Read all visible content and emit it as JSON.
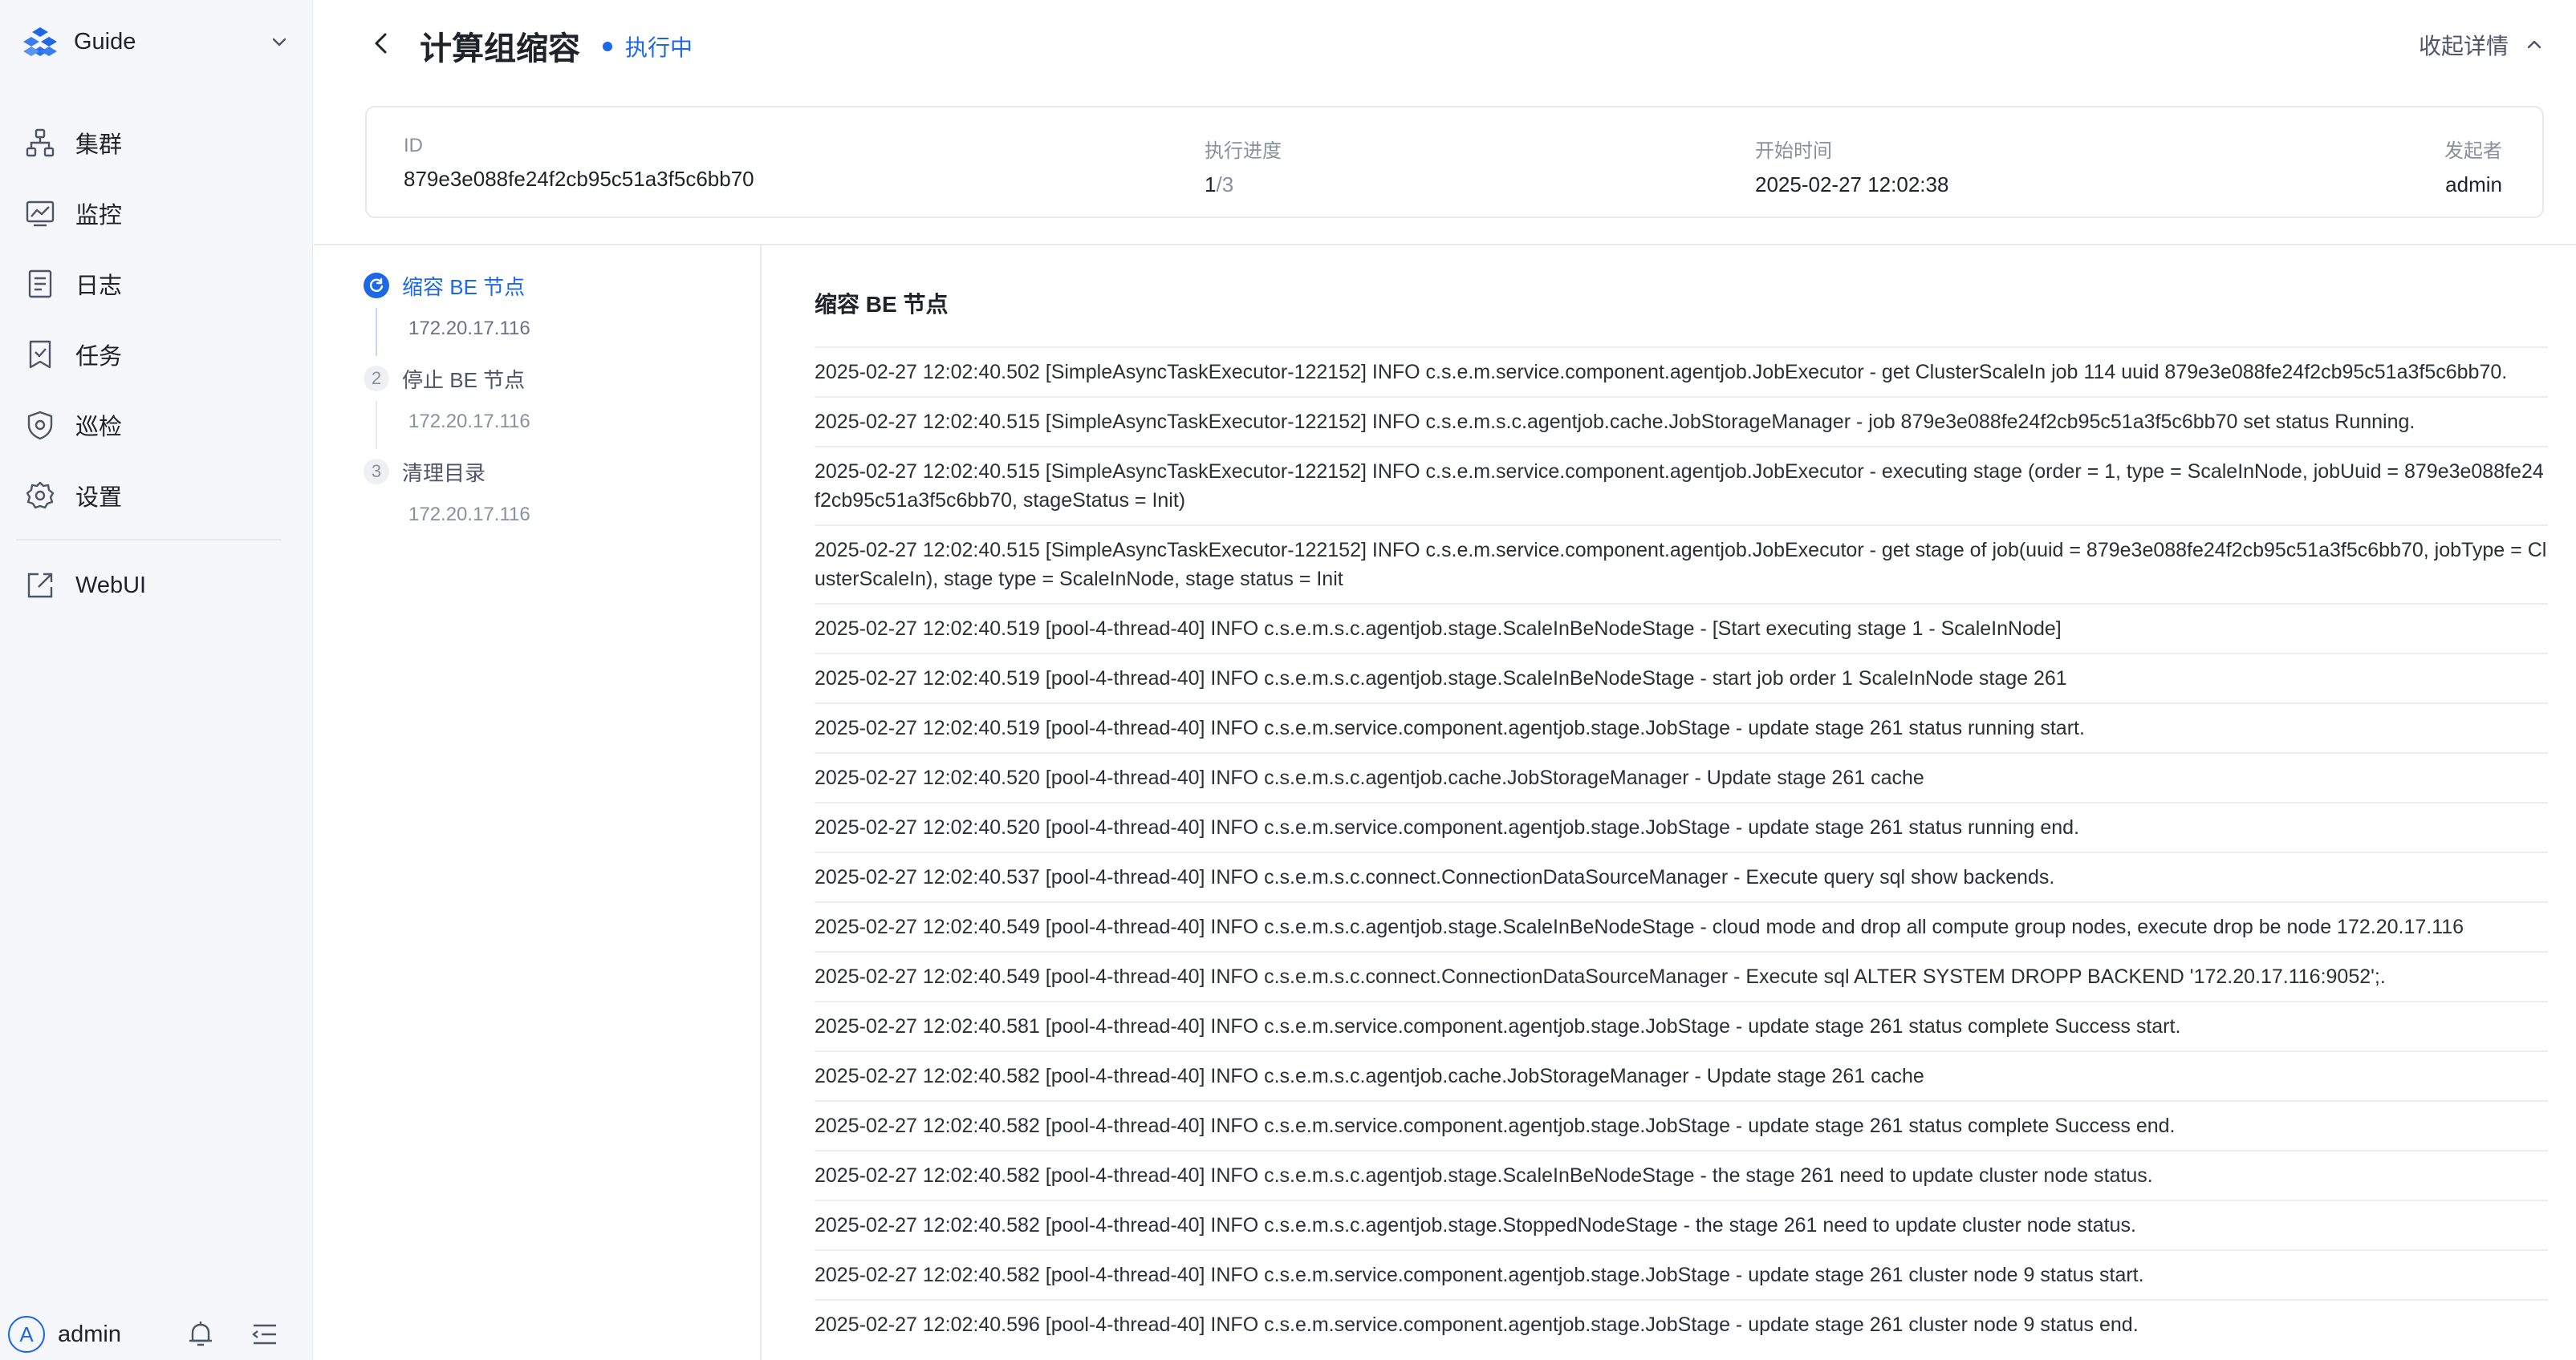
{
  "sidebar": {
    "brand": "Guide",
    "items": [
      {
        "label": "集群",
        "icon": "cluster-icon"
      },
      {
        "label": "监控",
        "icon": "monitor-icon"
      },
      {
        "label": "日志",
        "icon": "log-icon"
      },
      {
        "label": "任务",
        "icon": "task-icon"
      },
      {
        "label": "巡检",
        "icon": "inspection-icon"
      },
      {
        "label": "设置",
        "icon": "settings-icon"
      }
    ],
    "webui": {
      "label": "WebUI",
      "icon": "external-link-icon"
    },
    "user": {
      "avatar_letter": "A",
      "name": "admin"
    }
  },
  "header": {
    "title": "计算组缩容",
    "status": "执行中",
    "collapse_label": "收起详情"
  },
  "info": {
    "id_label": "ID",
    "id_value": "879e3e088fe24f2cb95c51a3f5c6bb70",
    "progress_label": "执行进度",
    "progress_current": "1",
    "progress_sep": "/",
    "progress_total": "3",
    "start_label": "开始时间",
    "start_value": "2025-02-27 12:02:38",
    "initiator_label": "发起者",
    "initiator_value": "admin"
  },
  "steps": [
    {
      "index": "1",
      "title": "缩容 BE 节点",
      "ip": "172.20.17.116",
      "active": true
    },
    {
      "index": "2",
      "title": "停止 BE 节点",
      "ip": "172.20.17.116",
      "active": false
    },
    {
      "index": "3",
      "title": "清理目录",
      "ip": "172.20.17.116",
      "active": false
    }
  ],
  "log": {
    "title": "缩容 BE 节点",
    "lines": [
      "2025-02-27 12:02:40.502 [SimpleAsyncTaskExecutor-122152] INFO  c.s.e.m.service.component.agentjob.JobExecutor - get ClusterScaleIn job 114 uuid 879e3e088fe24f2cb95c51a3f5c6bb70.",
      "2025-02-27 12:02:40.515 [SimpleAsyncTaskExecutor-122152] INFO  c.s.e.m.s.c.agentjob.cache.JobStorageManager - job 879e3e088fe24f2cb95c51a3f5c6bb70 set status Running.",
      "2025-02-27 12:02:40.515 [SimpleAsyncTaskExecutor-122152] INFO  c.s.e.m.service.component.agentjob.JobExecutor - executing stage (order = 1, type = ScaleInNode, jobUuid = 879e3e088fe24f2cb95c51a3f5c6bb70, stageStatus = Init)",
      "2025-02-27 12:02:40.515 [SimpleAsyncTaskExecutor-122152] INFO  c.s.e.m.service.component.agentjob.JobExecutor - get stage of job(uuid = 879e3e088fe24f2cb95c51a3f5c6bb70, jobType = ClusterScaleIn), stage type = ScaleInNode, stage status = Init",
      "2025-02-27 12:02:40.519 [pool-4-thread-40] INFO c.s.e.m.s.c.agentjob.stage.ScaleInBeNodeStage - [Start executing stage 1 - ScaleInNode]",
      "2025-02-27 12:02:40.519 [pool-4-thread-40] INFO  c.s.e.m.s.c.agentjob.stage.ScaleInBeNodeStage - start job order 1 ScaleInNode stage 261",
      "2025-02-27 12:02:40.519 [pool-4-thread-40] INFO  c.s.e.m.service.component.agentjob.stage.JobStage - update stage 261 status running start.",
      "2025-02-27 12:02:40.520 [pool-4-thread-40] INFO  c.s.e.m.s.c.agentjob.cache.JobStorageManager - Update stage 261 cache",
      "2025-02-27 12:02:40.520 [pool-4-thread-40] INFO  c.s.e.m.service.component.agentjob.stage.JobStage - update stage 261 status running end.",
      "2025-02-27 12:02:40.537 [pool-4-thread-40] INFO  c.s.e.m.s.c.connect.ConnectionDataSourceManager - Execute query sql show backends.",
      "2025-02-27 12:02:40.549 [pool-4-thread-40] INFO  c.s.e.m.s.c.agentjob.stage.ScaleInBeNodeStage - cloud mode and drop all compute group nodes, execute drop be node 172.20.17.116",
      "2025-02-27 12:02:40.549 [pool-4-thread-40] INFO  c.s.e.m.s.c.connect.ConnectionDataSourceManager - Execute sql ALTER SYSTEM DROPP BACKEND '172.20.17.116:9052';.",
      "2025-02-27 12:02:40.581 [pool-4-thread-40] INFO  c.s.e.m.service.component.agentjob.stage.JobStage - update stage 261 status complete Success start.",
      "2025-02-27 12:02:40.582 [pool-4-thread-40] INFO  c.s.e.m.s.c.agentjob.cache.JobStorageManager - Update stage 261 cache",
      "2025-02-27 12:02:40.582 [pool-4-thread-40] INFO  c.s.e.m.service.component.agentjob.stage.JobStage - update stage 261 status complete Success end.",
      "2025-02-27 12:02:40.582 [pool-4-thread-40] INFO  c.s.e.m.s.c.agentjob.stage.ScaleInBeNodeStage - the stage 261 need to update cluster node status.",
      "2025-02-27 12:02:40.582 [pool-4-thread-40] INFO  c.s.e.m.s.c.agentjob.stage.StoppedNodeStage - the stage 261 need to update cluster node status.",
      "2025-02-27 12:02:40.582 [pool-4-thread-40] INFO  c.s.e.m.service.component.agentjob.stage.JobStage - update stage 261 cluster node 9 status start.",
      "2025-02-27 12:02:40.596 [pool-4-thread-40] INFO  c.s.e.m.service.component.agentjob.stage.JobStage - update stage 261 cluster node 9 status end."
    ]
  },
  "colors": {
    "accent": "#1f68e5",
    "sidebar_bg": "#f5f7fb",
    "border": "#e6e8ee"
  }
}
